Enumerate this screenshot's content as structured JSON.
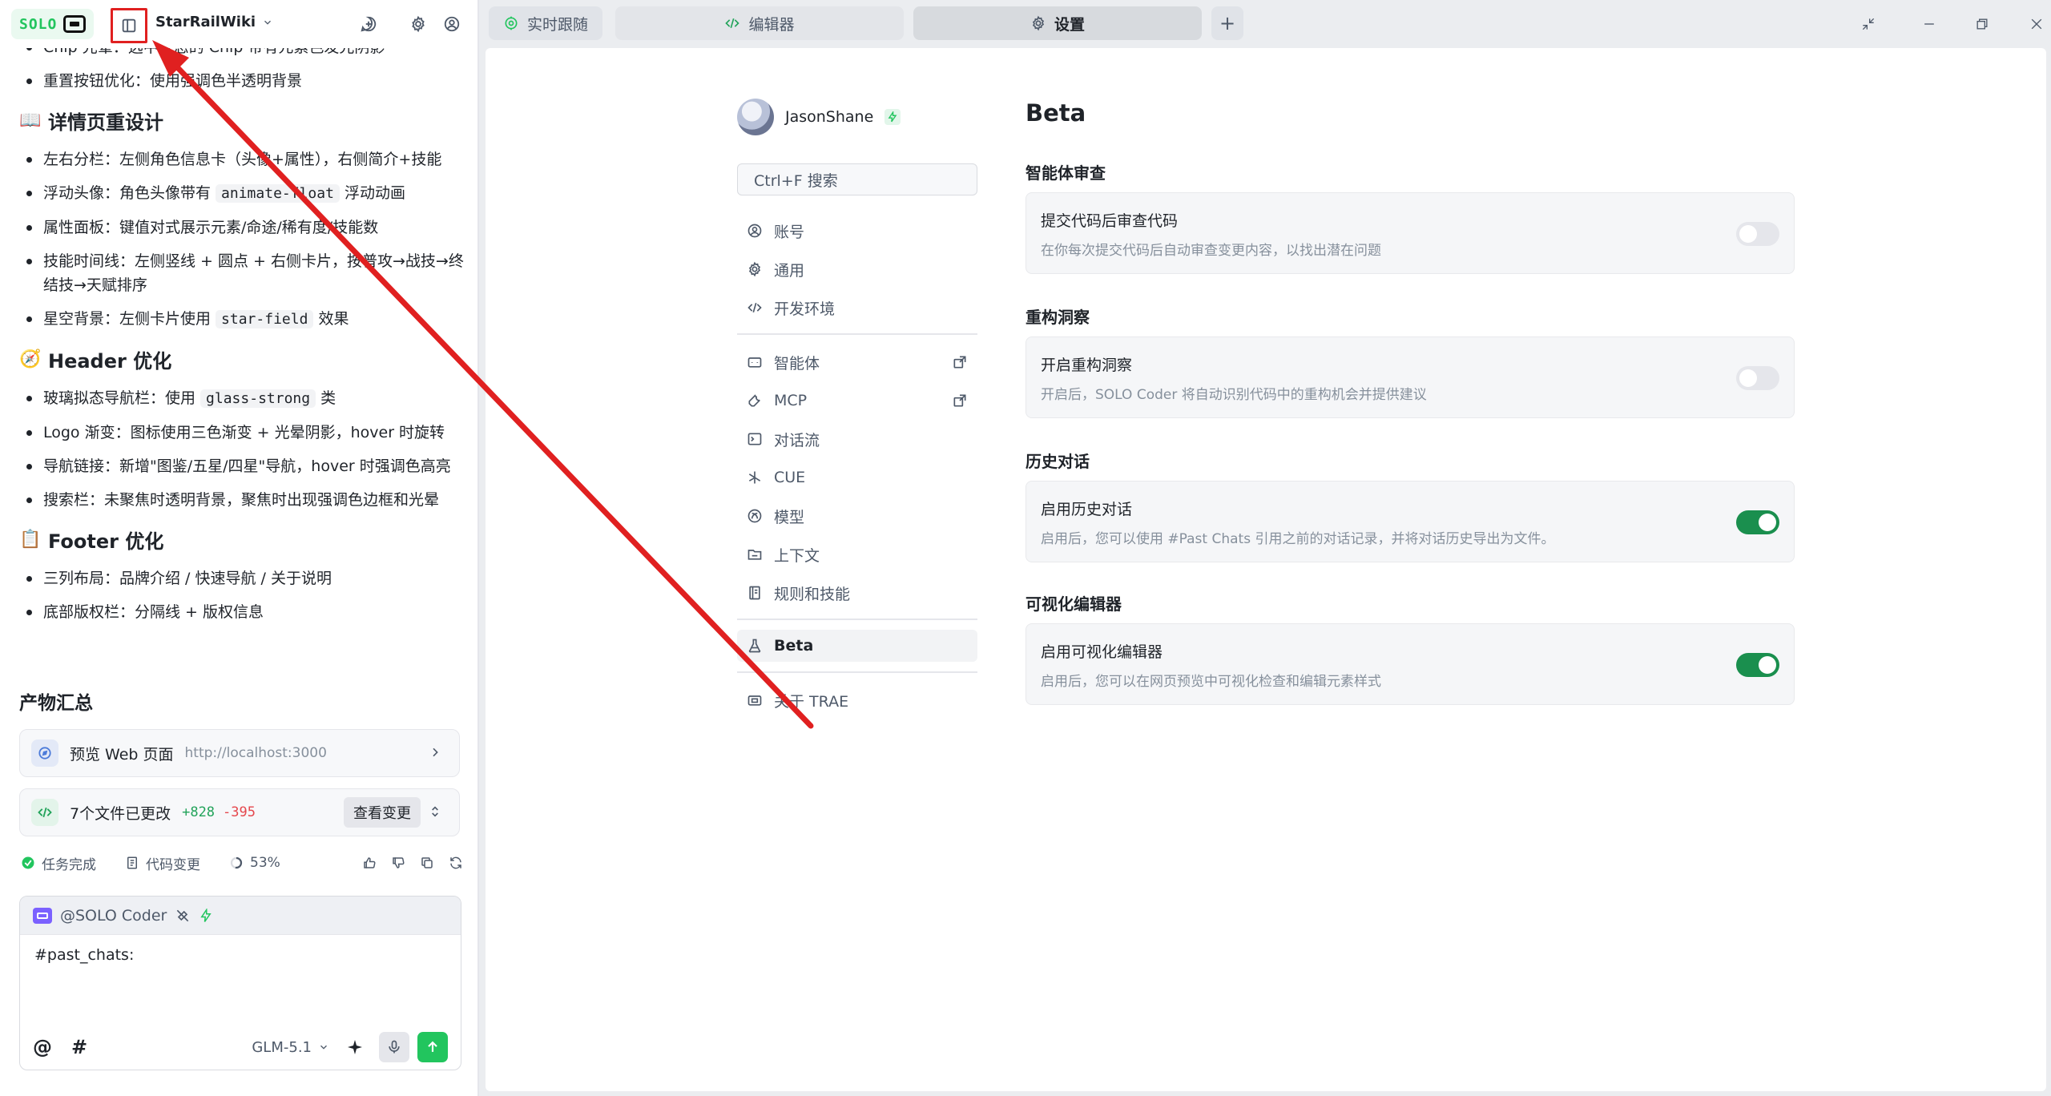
{
  "header": {
    "logo_text": "SOLO",
    "project_name": "StarRailWiki"
  },
  "content": {
    "item_top": "Chip 光晕：选中状态的 Chip 带有元素色发光阴影",
    "item_reset": "重置按钮优化：使用强调色半透明背景",
    "sec_detail": "详情页重设计",
    "detail_1": "左右分栏：左侧角色信息卡（头像+属性），右侧简介+技能",
    "detail_2_pre": "浮动头像：角色头像带有 ",
    "detail_2_code": "animate-float",
    "detail_2_post": " 浮动动画",
    "detail_3": "属性面板：键值对式展示元素/命途/稀有度/技能数",
    "detail_4": "技能时间线：左侧竖线 + 圆点 + 右侧卡片，按普攻→战技→终结技→天赋排序",
    "detail_5_pre": "星空背景：左侧卡片使用 ",
    "detail_5_code": "star-field",
    "detail_5_post": " 效果",
    "sec_header": "Header 优化",
    "header_1_pre": "玻璃拟态导航栏：使用 ",
    "header_1_code": "glass-strong",
    "header_1_post": " 类",
    "header_2": "Logo 渐变：图标使用三色渐变 + 光晕阴影，hover 时旋转",
    "header_3": "导航链接：新增\"图鉴/五星/四星\"导航，hover 时强调色高亮",
    "header_4": "搜索栏：未聚焦时透明背景，聚焦时出现强调色边框和光晕",
    "sec_footer": "Footer 优化",
    "footer_1": "三列布局：品牌介绍 / 快速导航 / 关于说明",
    "footer_2": "底部版权栏：分隔线 + 版权信息"
  },
  "artifacts": {
    "title": "产物汇总",
    "preview_label": "预览 Web 页面",
    "preview_url": "http://localhost:3000",
    "files_label": "7个文件已更改",
    "added": "+828",
    "removed": "-395",
    "view_changes": "查看变更"
  },
  "status": {
    "task_done": "任务完成",
    "code_changes": "代码变更",
    "progress": "53%"
  },
  "chat": {
    "agent": "@SOLO Coder",
    "input_text": "#past_chats:",
    "at_symbol": "@",
    "hash_symbol": "#",
    "model": "GLM-5.1"
  },
  "tabs": {
    "live": "实时跟随",
    "editor": "编辑器",
    "settings": "设置",
    "add": "+"
  },
  "settings_nav": {
    "username": "JasonShane",
    "search_placeholder": "Ctrl+F 搜索",
    "items": [
      "账号",
      "通用",
      "开发环境",
      "智能体",
      "MCP",
      "对话流",
      "CUE",
      "模型",
      "上下文",
      "规则和技能",
      "Beta",
      "关于 TRAE"
    ]
  },
  "beta": {
    "title": "Beta",
    "groups": [
      {
        "title": "智能体审查",
        "opt_title": "提交代码后审查代码",
        "opt_desc": "在你每次提交代码后自动审查变更内容，以找出潜在问题",
        "enabled": false
      },
      {
        "title": "重构洞察",
        "opt_title": "开启重构洞察",
        "opt_desc": "开启后，SOLO Coder 将自动识别代码中的重构机会并提供建议",
        "enabled": false
      },
      {
        "title": "历史对话",
        "opt_title": "启用历史对话",
        "opt_desc": "启用后，您可以使用 #Past Chats 引用之前的对话记录，并将对话历史导出为文件。",
        "enabled": true
      },
      {
        "title": "可视化编辑器",
        "opt_title": "启用可视化编辑器",
        "opt_desc": "启用后，您可以在网页预览中可视化检查和编辑元素样式",
        "enabled": true
      }
    ]
  },
  "colors": {
    "accent_green": "#22c55e",
    "toggle_on": "#1a8f4e",
    "annotation_red": "#e02020"
  }
}
